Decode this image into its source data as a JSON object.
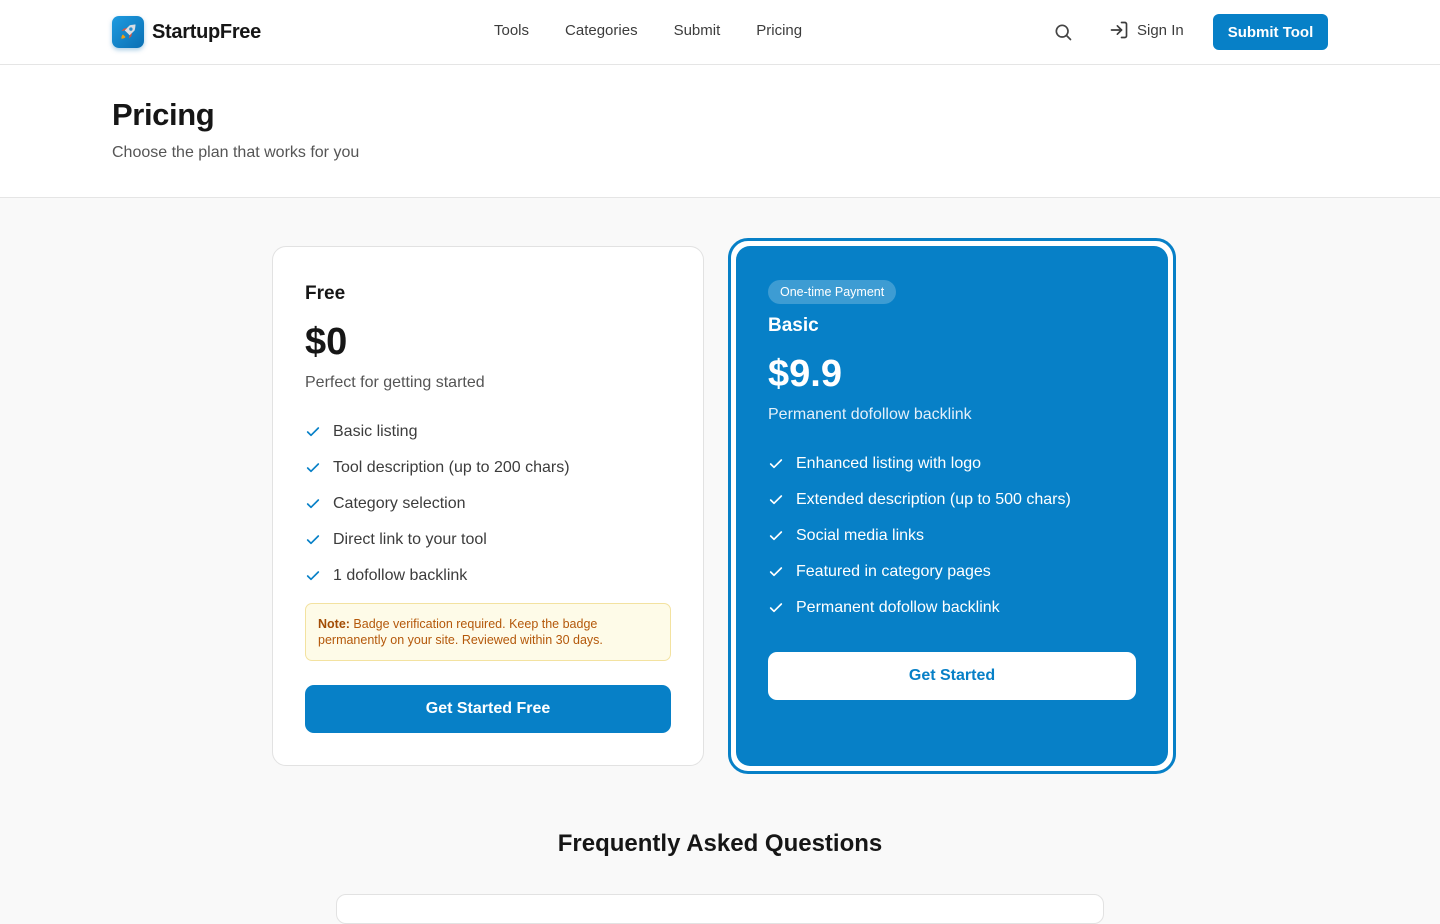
{
  "header": {
    "brand": "StartupFree",
    "nav": [
      "Tools",
      "Categories",
      "Submit",
      "Pricing"
    ],
    "sign_in": "Sign In",
    "submit_tool": "Submit Tool"
  },
  "page": {
    "title": "Pricing",
    "subtitle": "Choose the plan that works for you"
  },
  "plans": {
    "free": {
      "name": "Free",
      "price": "$0",
      "description": "Perfect for getting started",
      "features": [
        "Basic listing",
        "Tool description (up to 200 chars)",
        "Category selection",
        "Direct link to your tool",
        "1 dofollow backlink"
      ],
      "note_label": "Note:",
      "note_text": " Badge verification required. Keep the badge permanently on your site. Reviewed within 30 days.",
      "button": "Get Started Free"
    },
    "basic": {
      "badge": "One-time Payment",
      "name": "Basic",
      "price": "$9.9",
      "description": "Permanent dofollow backlink",
      "features": [
        "Enhanced listing with logo",
        "Extended description (up to 500 chars)",
        "Social media links",
        "Featured in category pages",
        "Permanent dofollow backlink"
      ],
      "button": "Get Started"
    }
  },
  "faq": {
    "title": "Frequently Asked Questions"
  },
  "colors": {
    "primary": "#0780c7",
    "note_bg": "#fefbe8",
    "note_text": "#b4580a"
  },
  "icons": {
    "logo": "rocket-icon",
    "search": "search-icon",
    "sign_in": "sign-in-icon",
    "feature": "check-icon"
  }
}
